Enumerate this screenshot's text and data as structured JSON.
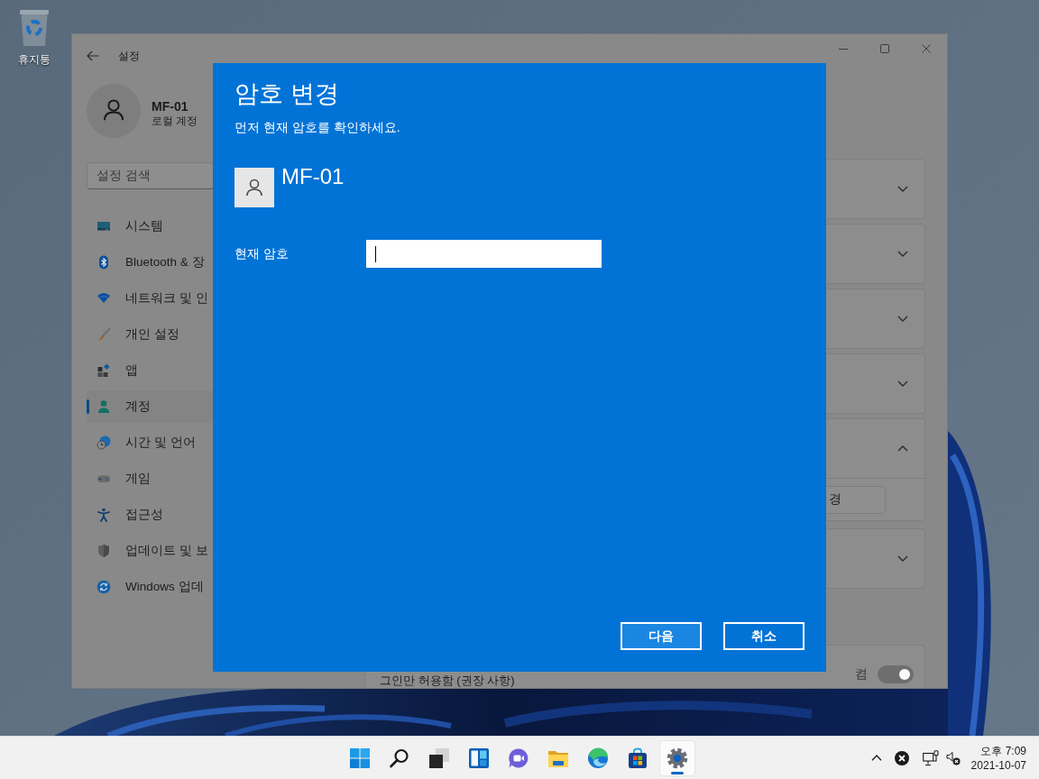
{
  "desktop": {
    "icons": [
      {
        "label": "휴지통"
      }
    ]
  },
  "settings_window": {
    "title": "설정",
    "profile": {
      "name": "MF-01",
      "account_type": "로컬 계정"
    },
    "search": {
      "placeholder": "설정 검색"
    },
    "nav_items": [
      {
        "kind": "system",
        "label": "시스템",
        "selected": false
      },
      {
        "kind": "bluetooth",
        "label": "Bluetooth & 장",
        "selected": false
      },
      {
        "kind": "network",
        "label": "네트워크 및 인",
        "selected": false
      },
      {
        "kind": "personalization",
        "label": "개인 설정",
        "selected": false
      },
      {
        "kind": "apps",
        "label": "앱",
        "selected": false
      },
      {
        "kind": "accounts",
        "label": "계정",
        "selected": true
      },
      {
        "kind": "time",
        "label": "시간 및 언어",
        "selected": false
      },
      {
        "kind": "gaming",
        "label": "게임",
        "selected": false
      },
      {
        "kind": "accessibility",
        "label": "접근성",
        "selected": false
      },
      {
        "kind": "security",
        "label": "업데이트 및 보",
        "selected": false
      },
      {
        "kind": "update",
        "label": "Windows 업데",
        "selected": false
      }
    ],
    "cards": [
      {
        "expanded": false
      },
      {
        "expanded": false
      },
      {
        "expanded": false
      },
      {
        "expanded": false
      },
      {
        "expanded": true,
        "button": "경"
      },
      {
        "expanded": false
      }
    ],
    "bottom_card": {
      "text": "그인만 허용함 (권장 사항)",
      "toggle": {
        "label": "켬",
        "on": true
      }
    }
  },
  "dialog": {
    "title": "암호 변경",
    "subtitle": "먼저 현재 암호를 확인하세요.",
    "user": {
      "name": "MF-01"
    },
    "field": {
      "label": "현재 암호",
      "focused": true
    },
    "buttons": [
      {
        "label": "다음",
        "default": true
      },
      {
        "label": "취소",
        "default": false
      }
    ]
  },
  "taskbar": {
    "apps": [
      {
        "kind": "start",
        "selected": false
      },
      {
        "kind": "search",
        "selected": false
      },
      {
        "kind": "taskview",
        "selected": false
      },
      {
        "kind": "widgets",
        "selected": false
      },
      {
        "kind": "chat",
        "selected": false
      },
      {
        "kind": "folder",
        "selected": false
      },
      {
        "kind": "browser",
        "selected": false
      },
      {
        "kind": "store",
        "selected": false
      },
      {
        "kind": "settings",
        "selected": true
      }
    ],
    "clock": {
      "time": "오후 7:09",
      "date": "2021-10-07"
    }
  }
}
